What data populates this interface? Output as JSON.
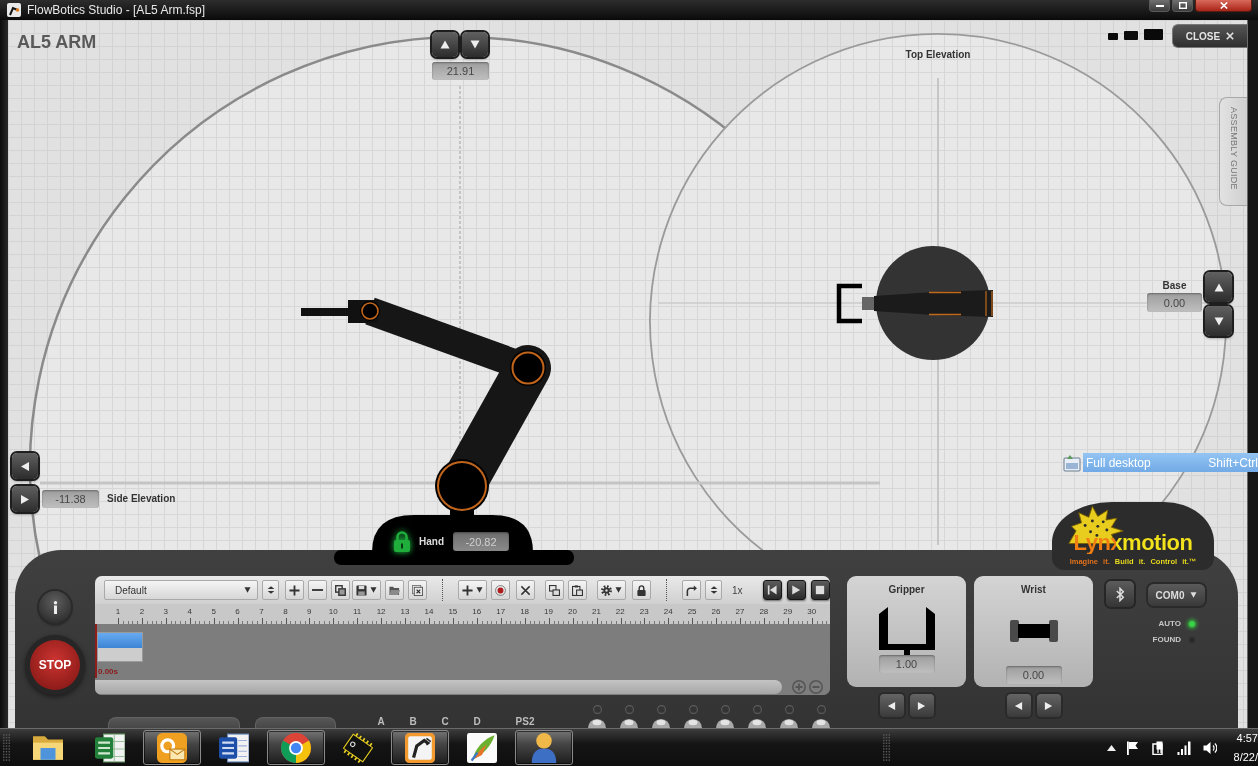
{
  "window": {
    "title": "FlowBotics Studio - [AL5 Arm.fsp]"
  },
  "header": {
    "title": "AL5 ARM",
    "close_label": "CLOSE",
    "side_tab": "ASSEMBLY GUIDE"
  },
  "side_elevation": {
    "label": "Side Elevation",
    "vertical_value": "21.91",
    "horizontal_value": "-11.38"
  },
  "top_elevation": {
    "label": "Top Elevation",
    "base_label": "Base",
    "base_value": "0.00"
  },
  "hand": {
    "label": "Hand",
    "value": "-20.82",
    "locked": true
  },
  "context_menu_item": {
    "label": "Full desktop",
    "shortcut": "Shift+Ctrl",
    "selected": true
  },
  "logo": {
    "name": "Lynxmotion",
    "tagline": "Imagine it. Build it. Control it.™"
  },
  "stop_button": {
    "label": "STOP"
  },
  "timeline": {
    "sequence": "Default",
    "speed": "1x",
    "ruler": [
      "1",
      "2",
      "3",
      "4",
      "5",
      "6",
      "7",
      "8",
      "9",
      "10",
      "11",
      "12",
      "13",
      "14",
      "15",
      "16",
      "17",
      "18",
      "19",
      "20",
      "21",
      "22",
      "23",
      "24",
      "25",
      "26",
      "27",
      "28",
      "29",
      "30"
    ],
    "time": "0.00s",
    "keyframes": [
      {
        "selected": true
      }
    ]
  },
  "joints": [
    {
      "kind": "gripper",
      "label": "Gripper",
      "value": "1.00"
    },
    {
      "kind": "wrist",
      "label": "Wrist",
      "value": "0.00"
    }
  ],
  "connection": {
    "port": "COM0",
    "indicators": [
      {
        "label": "AUTO",
        "on": true
      },
      {
        "label": "FOUND",
        "on": false
      }
    ]
  },
  "channels": [
    "A",
    "B",
    "C",
    "D",
    "PS2"
  ],
  "taskbar": {
    "apps": [
      {
        "kind": "folder",
        "running": false
      },
      {
        "kind": "spreadsheet",
        "running": false
      },
      {
        "kind": "mail",
        "running": true
      },
      {
        "kind": "document",
        "running": false
      },
      {
        "kind": "browser",
        "running": true
      },
      {
        "kind": "chip",
        "running": false
      },
      {
        "kind": "robot-arm",
        "running": true
      },
      {
        "kind": "paint",
        "running": false
      },
      {
        "kind": "person",
        "running": true
      }
    ],
    "time": "4:57",
    "date": "8/22/"
  }
}
